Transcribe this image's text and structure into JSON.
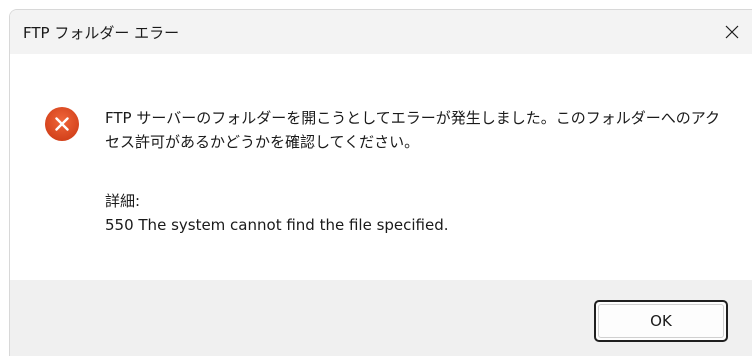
{
  "window": {
    "title": "FTP フォルダー エラー",
    "close_glyph": "✕"
  },
  "content": {
    "icon": "error-circle-x-icon",
    "icon_color": "#e0481c",
    "message": "FTP サーバーのフォルダーを開こうとしてエラーが発生しました。このフォルダーへのアクセス許可があるかどうかを確認してください。",
    "details_label": "詳細:",
    "details_text": "550 The system cannot find the file specified."
  },
  "footer": {
    "ok_label": "OK"
  }
}
